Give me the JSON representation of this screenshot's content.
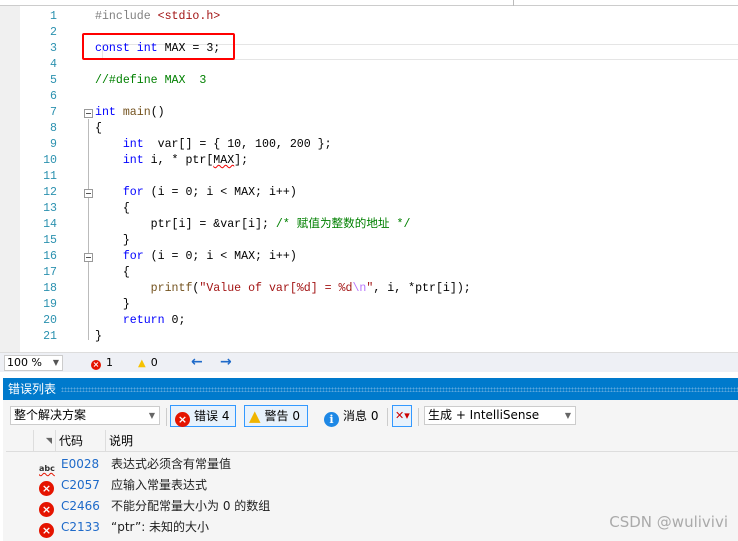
{
  "editor": {
    "lines": [
      {
        "n": "1",
        "tokens": [
          [
            "#include ",
            "pp"
          ],
          [
            "<stdio.h>",
            "str"
          ]
        ]
      },
      {
        "n": "2",
        "tokens": []
      },
      {
        "n": "3",
        "tokens": [
          [
            "const",
            "kw"
          ],
          [
            " ",
            "tx"
          ],
          [
            "int",
            "kw"
          ],
          [
            " MAX = 3;",
            "tx"
          ]
        ]
      },
      {
        "n": "4",
        "tokens": []
      },
      {
        "n": "5",
        "tokens": [
          [
            "//#define MAX  3",
            "cm"
          ]
        ]
      },
      {
        "n": "6",
        "tokens": []
      },
      {
        "n": "7",
        "tokens": [
          [
            "int",
            "kw"
          ],
          [
            " ",
            "tx"
          ],
          [
            "main",
            "fn"
          ],
          [
            "()",
            "tx"
          ]
        ]
      },
      {
        "n": "8",
        "tokens": [
          [
            "{",
            "tx"
          ]
        ]
      },
      {
        "n": "9",
        "tokens": [
          [
            "    ",
            "tx"
          ],
          [
            "int",
            "kw"
          ],
          [
            "  var[] = { 10, 100, 200 };",
            "tx"
          ]
        ]
      },
      {
        "n": "10",
        "tokens": [
          [
            "    ",
            "tx"
          ],
          [
            "int",
            "kw"
          ],
          [
            " i, * ptr[",
            "tx"
          ],
          [
            "MAX",
            "sq"
          ],
          [
            "];",
            "tx"
          ]
        ]
      },
      {
        "n": "11",
        "tokens": []
      },
      {
        "n": "12",
        "tokens": [
          [
            "    ",
            "tx"
          ],
          [
            "for",
            "kw"
          ],
          [
            " (i = 0; i < MAX; i++)",
            "tx"
          ]
        ]
      },
      {
        "n": "13",
        "tokens": [
          [
            "    {",
            "tx"
          ]
        ]
      },
      {
        "n": "14",
        "tokens": [
          [
            "        ptr[i] = &var[i]; ",
            "tx"
          ],
          [
            "/* 赋值为整数的地址 */",
            "cm"
          ]
        ]
      },
      {
        "n": "15",
        "tokens": [
          [
            "    }",
            "tx"
          ]
        ]
      },
      {
        "n": "16",
        "tokens": [
          [
            "    ",
            "tx"
          ],
          [
            "for",
            "kw"
          ],
          [
            " (i = 0; i < MAX; i++)",
            "tx"
          ]
        ]
      },
      {
        "n": "17",
        "tokens": [
          [
            "    {",
            "tx"
          ]
        ]
      },
      {
        "n": "18",
        "tokens": [
          [
            "        ",
            "tx"
          ],
          [
            "printf",
            "fn"
          ],
          [
            "(",
            "tx"
          ],
          [
            "\"Value of var[%d] = %d",
            "str"
          ],
          [
            "\\n",
            "esc"
          ],
          [
            "\"",
            "str"
          ],
          [
            ", i, *ptr[i]);",
            "tx"
          ]
        ]
      },
      {
        "n": "19",
        "tokens": [
          [
            "    }",
            "tx"
          ]
        ]
      },
      {
        "n": "20",
        "tokens": [
          [
            "    ",
            "tx"
          ],
          [
            "return",
            "kw"
          ],
          [
            " 0;",
            "tx"
          ]
        ]
      },
      {
        "n": "21",
        "tokens": [
          [
            "}",
            "tx"
          ]
        ]
      }
    ],
    "fold_lines": [
      "7",
      "12",
      "16"
    ]
  },
  "status": {
    "zoom": "100 %",
    "errors": "1",
    "warnings": "0"
  },
  "error_list": {
    "title": "错误列表",
    "scope": "整个解决方案",
    "errors_btn": "错误 4",
    "warnings_btn": "警告 0",
    "messages_btn": "消息 0",
    "source": "生成 + IntelliSense",
    "columns": {
      "code": "代码",
      "desc": "说明"
    },
    "rows": [
      {
        "icon": "intellisense-error-icon",
        "code": "E0028",
        "desc": "表达式必须含有常量值"
      },
      {
        "icon": "error-icon",
        "code": "C2057",
        "desc": "应输入常量表达式"
      },
      {
        "icon": "error-icon",
        "code": "C2466",
        "desc": "不能分配常量大小为 0 的数组"
      },
      {
        "icon": "error-icon",
        "code": "C2133",
        "desc": "“ptr”: 未知的大小"
      }
    ]
  },
  "watermark": "CSDN @wulivivi",
  "colors": {
    "accent": "#007acc",
    "error": "#e51400",
    "highlight_box": "#ff0000"
  }
}
